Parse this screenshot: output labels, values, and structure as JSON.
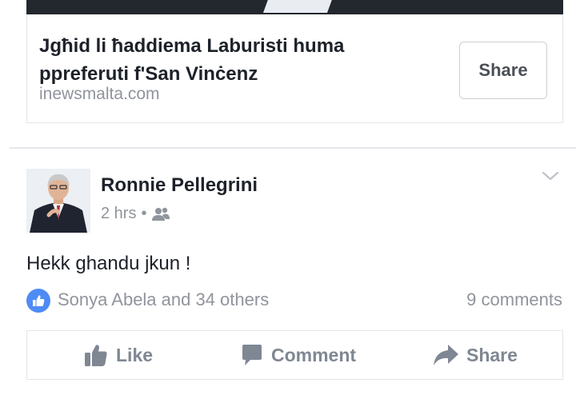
{
  "link_preview": {
    "title": "Jgħid li ħaddiema Laburisti huma ppreferuti f'San Vinċenz",
    "domain": "inewsmalta.com",
    "share_label": "Share"
  },
  "post": {
    "author": "Ronnie Pellegrini",
    "time": "2 hrs",
    "separator": "•",
    "audience_icon": "friends-icon",
    "text": "Hekk ghandu jkun !",
    "reactions_text": "Sonya Abela and 34 others",
    "comments_text": "9 comments"
  },
  "actions": {
    "like_label": "Like",
    "comment_label": "Comment",
    "share_label": "Share"
  },
  "colors": {
    "text": "#1d2129",
    "secondary": "#90949c",
    "action": "#7f8792",
    "like_blue": "#4f8bf5"
  }
}
